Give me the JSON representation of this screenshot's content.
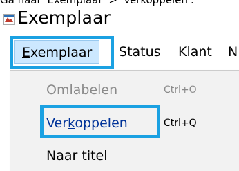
{
  "top_strip": {
    "text": "Ga naar 'Exemplaar' > 'Verkoppelen'."
  },
  "window": {
    "title": "Exemplaar",
    "icon": "app-icon"
  },
  "menubar": {
    "items": [
      {
        "mnemonic": "E",
        "rest": "xemplaar",
        "active": true
      },
      {
        "mnemonic": "S",
        "rest": "tatus",
        "active": false
      },
      {
        "mnemonic": "K",
        "rest": "lant",
        "active": false
      },
      {
        "mnemonic": "N",
        "rest": "",
        "active": false
      }
    ]
  },
  "dropdown": {
    "items": [
      {
        "label": "Omlabelen",
        "shortcut": "Ctrl+O",
        "enabled": false
      },
      {
        "label_pre": "Ver",
        "label_mn": "k",
        "label_post": "oppelen",
        "shortcut": "Ctrl+Q",
        "enabled": true
      },
      {
        "label_pre": "Naar ",
        "label_mn": "t",
        "label_post": "itel",
        "shortcut": "",
        "enabled": true
      }
    ]
  },
  "highlight_color": "#1ba1e2",
  "colors": {
    "active_menu_bg": "#cce8ff",
    "dropdown_bg": "#f2f2f2",
    "disabled_text": "#8a8a8a",
    "link_text": "#003399"
  }
}
